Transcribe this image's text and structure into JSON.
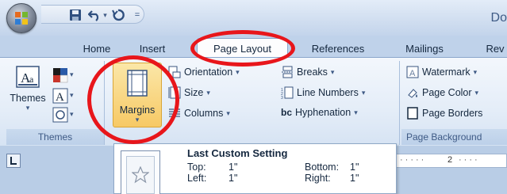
{
  "titlebar": {
    "title": "Do"
  },
  "tabs": [
    {
      "label": "Home"
    },
    {
      "label": "Insert"
    },
    {
      "label": "Page Layout"
    },
    {
      "label": "References"
    },
    {
      "label": "Mailings"
    },
    {
      "label": "Rev"
    }
  ],
  "groups": {
    "themes": {
      "label": "Themes",
      "themes_button": "Themes"
    },
    "page_setup": {
      "margins_button": "Margins",
      "orientation": "Orientation",
      "size": "Size",
      "columns": "Columns",
      "breaks": "Breaks",
      "line_numbers": "Line Numbers",
      "hyphenation": "Hyphenation",
      "hyphenation_icon": "bc"
    },
    "page_background": {
      "label": "Page Background",
      "watermark": "Watermark",
      "page_color": "Page Color",
      "page_borders": "Page Borders"
    }
  },
  "dropdown": {
    "title": "Last Custom Setting",
    "top_label": "Top:",
    "top_value": "1\"",
    "bottom_label": "Bottom:",
    "bottom_value": "1\"",
    "left_label": "Left:",
    "left_value": "1\"",
    "right_label": "Right:",
    "right_value": "1\""
  },
  "ruler": {
    "marker": "2"
  },
  "colors": {
    "annotation": "#e8161b",
    "ribbon": "#dce7f5",
    "accent": "#3e5a85"
  },
  "icons": [
    "office-button-icon",
    "save-icon",
    "undo-icon",
    "redo-icon",
    "customize-qat-icon",
    "themes-icon",
    "colors-icon",
    "fonts-icon",
    "effects-icon",
    "margins-icon",
    "orientation-icon",
    "size-icon",
    "columns-icon",
    "breaks-icon",
    "line-numbers-icon",
    "hyphenation-icon",
    "watermark-icon",
    "page-color-icon",
    "page-borders-icon",
    "star-icon",
    "tab-stop-icon"
  ]
}
